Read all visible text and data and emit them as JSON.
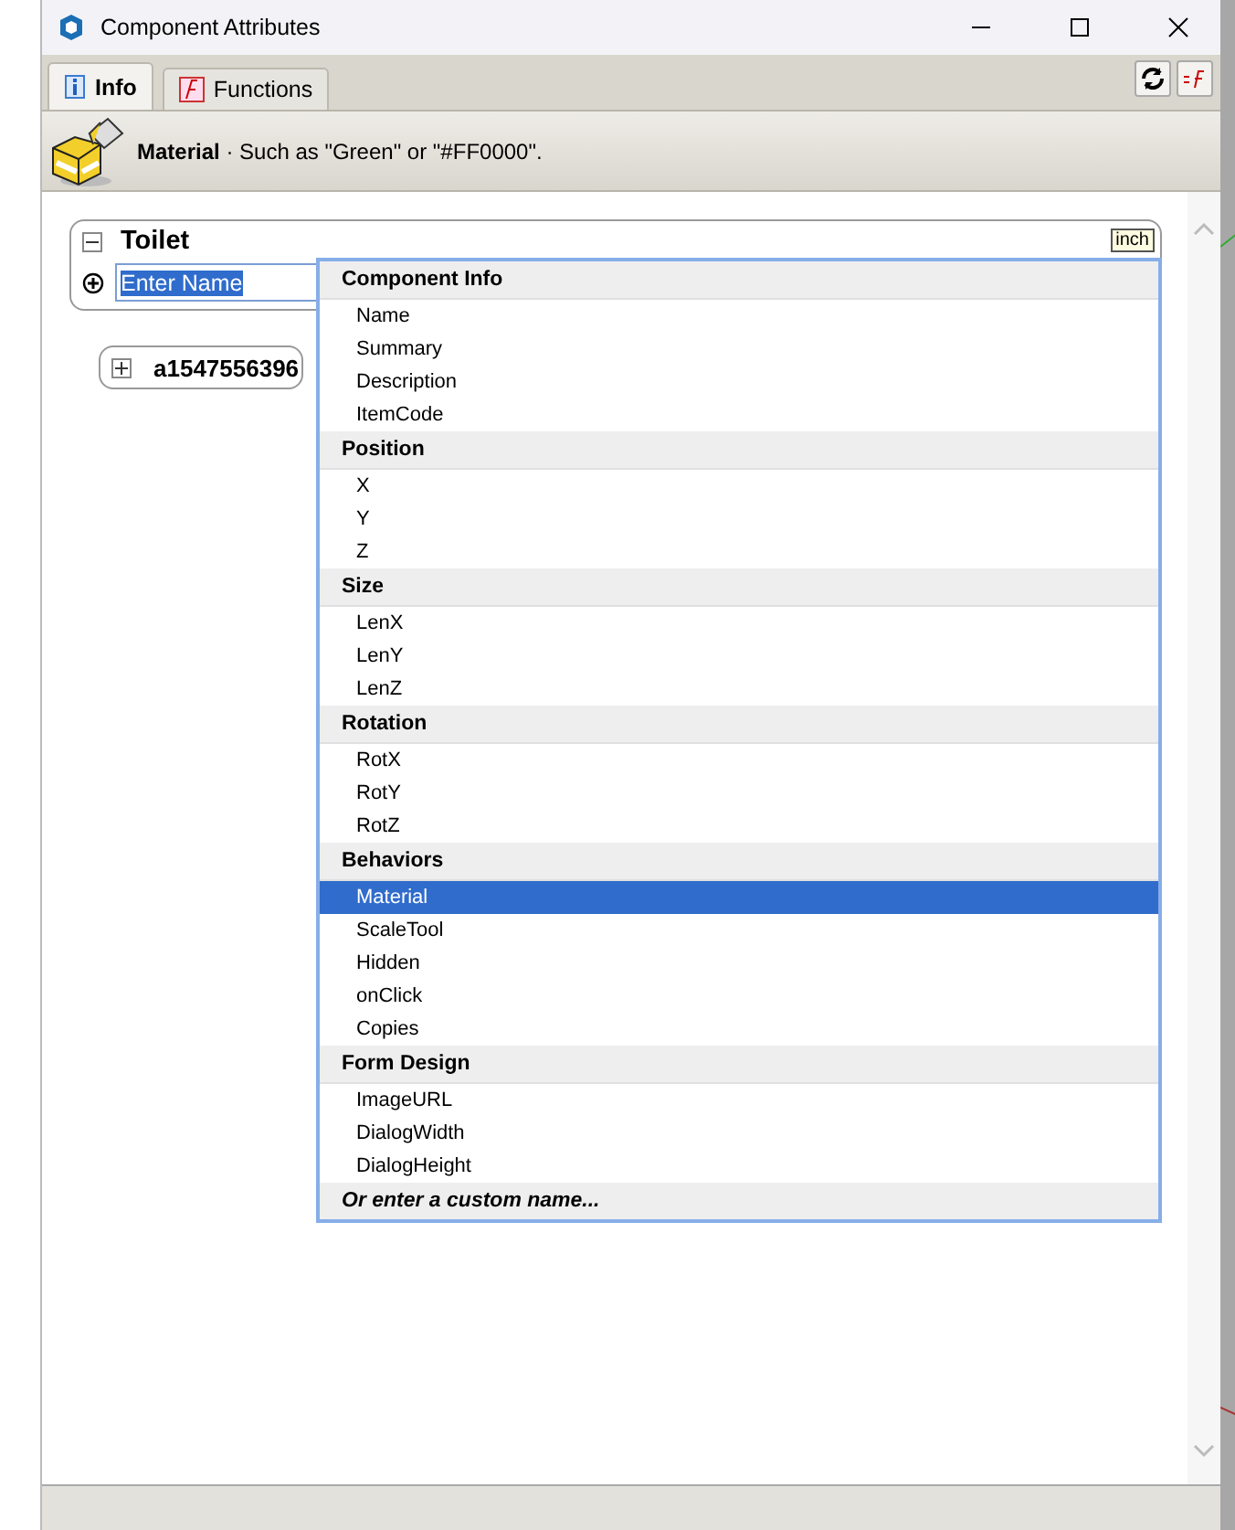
{
  "window": {
    "title": "Component Attributes"
  },
  "tabs": [
    {
      "label": "Info",
      "selected": true
    },
    {
      "label": "Functions",
      "selected": false
    }
  ],
  "info_bar": {
    "attribute": "Material",
    "hint": " · Such as \"Green\" or \"#FF0000\"."
  },
  "component": {
    "name": "Toilet",
    "expanded": true,
    "units": "inch",
    "name_field": {
      "value": "Enter Name",
      "selected": true
    }
  },
  "subcomponents": [
    {
      "name": "a1547556396",
      "expanded": false
    }
  ],
  "dropdown": {
    "groups": [
      {
        "title": "Component Info",
        "items": [
          {
            "label": "Name",
            "selected": false
          },
          {
            "label": "Summary",
            "selected": false
          },
          {
            "label": "Description",
            "selected": false
          },
          {
            "label": "ItemCode",
            "selected": false
          }
        ]
      },
      {
        "title": "Position",
        "items": [
          {
            "label": "X",
            "selected": false
          },
          {
            "label": "Y",
            "selected": false
          },
          {
            "label": "Z",
            "selected": false
          }
        ]
      },
      {
        "title": "Size",
        "items": [
          {
            "label": "LenX",
            "selected": false
          },
          {
            "label": "LenY",
            "selected": false
          },
          {
            "label": "LenZ",
            "selected": false
          }
        ]
      },
      {
        "title": "Rotation",
        "items": [
          {
            "label": "RotX",
            "selected": false
          },
          {
            "label": "RotY",
            "selected": false
          },
          {
            "label": "RotZ",
            "selected": false
          }
        ]
      },
      {
        "title": "Behaviors",
        "items": [
          {
            "label": "Material",
            "selected": true
          },
          {
            "label": "ScaleTool",
            "selected": false
          },
          {
            "label": "Hidden",
            "selected": false
          },
          {
            "label": "onClick",
            "selected": false
          },
          {
            "label": "Copies",
            "selected": false
          }
        ]
      },
      {
        "title": "Form Design",
        "items": [
          {
            "label": "ImageURL",
            "selected": false
          },
          {
            "label": "DialogWidth",
            "selected": false
          },
          {
            "label": "DialogHeight",
            "selected": false
          }
        ]
      }
    ],
    "footer": "Or enter a custom name..."
  }
}
